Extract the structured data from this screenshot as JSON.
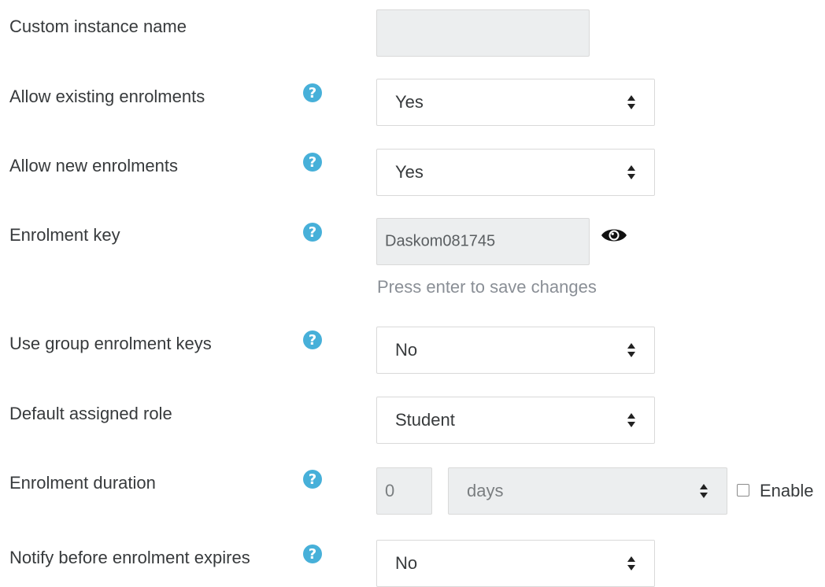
{
  "fields": {
    "custom_instance_name": {
      "label": "Custom instance name",
      "value": ""
    },
    "allow_existing": {
      "label": "Allow existing enrolments",
      "value": "Yes"
    },
    "allow_new": {
      "label": "Allow new enrolments",
      "value": "Yes"
    },
    "enrolment_key": {
      "label": "Enrolment key",
      "value": "Daskom081745",
      "hint": "Press enter to save changes"
    },
    "group_keys": {
      "label": "Use group enrolment keys",
      "value": "No"
    },
    "default_role": {
      "label": "Default assigned role",
      "value": "Student"
    },
    "duration": {
      "label": "Enrolment duration",
      "number": "0",
      "unit": "days",
      "enable_label": "Enable",
      "enabled": false
    },
    "notify": {
      "label": "Notify before enrolment expires",
      "value": "No"
    }
  },
  "icons": {
    "help": "question-circle-icon",
    "reveal": "eye-icon",
    "select": "sort-arrows-icon"
  },
  "colors": {
    "help_icon": "#47b0d9",
    "hint_text": "#8a8f96",
    "disabled_bg": "#eceeef"
  }
}
